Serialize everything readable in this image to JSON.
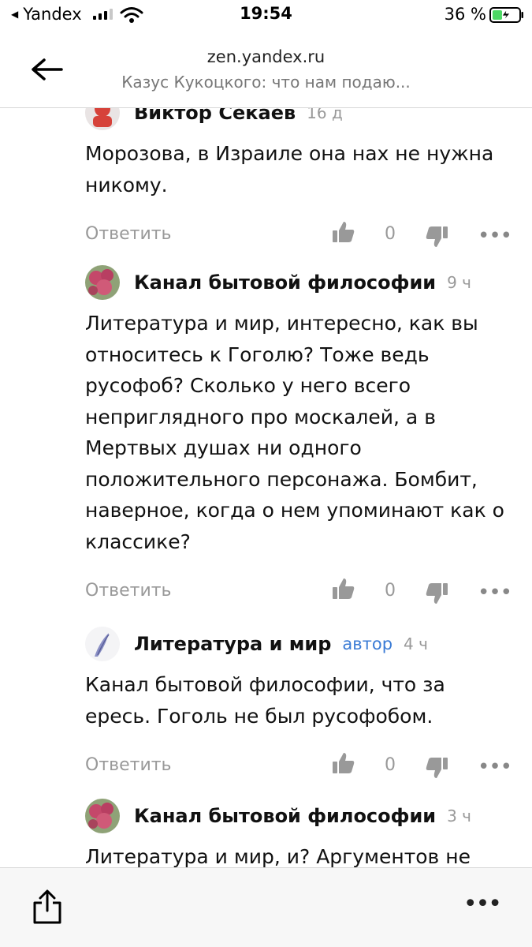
{
  "statusbar": {
    "back_app": "Yandex",
    "time": "19:54",
    "battery_pct": "36 %"
  },
  "header": {
    "domain": "zen.yandex.ru",
    "page_title": "Казус Кукоцкого: что нам подаю..."
  },
  "comments": [
    {
      "author": "Виктор Секаев",
      "time": "16 д",
      "text": "Морозова, в Израиле она нах не нужна никому.",
      "reply_label": "Ответить",
      "like_count": "0"
    },
    {
      "author": "Канал бытовой философии",
      "time": "9 ч",
      "text": "Литература и мир, интересно, как вы относитесь к Гоголю? Тоже ведь русофоб? Сколько у него всего неприглядного про москалей, а в Мертвых душах ни одного положительного персонажа. Бомбит, наверное, когда о нем упоминают как о классике?",
      "reply_label": "Ответить",
      "like_count": "0"
    },
    {
      "author": "Литература и мир",
      "author_tag": "автор",
      "time": "4 ч",
      "text": "Канал бытовой философии, что за ересь. Гоголь не был русофобом.",
      "reply_label": "Ответить",
      "like_count": "0"
    },
    {
      "author": "Канал бытовой философии",
      "time": "3 ч",
      "text": "Литература и мир, и? Аргументов не"
    }
  ],
  "icons": {
    "back": "arrow-left-icon",
    "like": "thumbs-up-icon",
    "dislike": "thumbs-down-icon",
    "more": "more-horizontal-icon",
    "share": "share-icon",
    "menu": "more-horizontal-icon"
  },
  "colors": {
    "author_tag": "#3a7bd5",
    "muted": "#999999",
    "battery_fill": "#4cd964"
  }
}
